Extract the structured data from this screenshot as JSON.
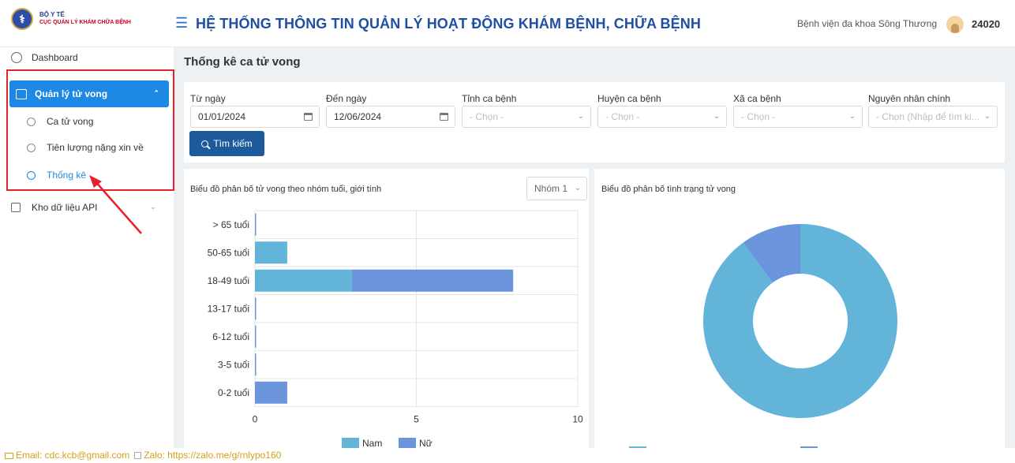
{
  "header": {
    "org_line1": "BỘ Y TẾ",
    "org_line2": "CỤC QUẢN LÝ KHÁM CHỮA BỆNH",
    "title": "HỆ THỐNG THÔNG TIN QUẢN LÝ HOẠT ĐỘNG KHÁM BỆNH, CHỮA BỆNH",
    "hospital": "Bệnh viện đa khoa Sông Thương",
    "user_id": "24020"
  },
  "sidebar": {
    "dashboard": "Dashboard",
    "group_label": "Quản lý tử vong",
    "sub_items": [
      "Ca tử vong",
      "Tiên lượng nặng xin về",
      "Thống kê"
    ],
    "api": "Kho dữ liệu API"
  },
  "page": {
    "title": "Thống kê ca tử vong"
  },
  "filters": {
    "from_label": "Từ ngày",
    "from_value": "01/01/2024",
    "to_label": "Đến ngày",
    "to_value": "12/06/2024",
    "province_label": "Tỉnh ca bệnh",
    "province_placeholder": "- Chọn -",
    "district_label": "Huyện ca bệnh",
    "district_placeholder": "- Chọn -",
    "ward_label": "Xã ca bệnh",
    "ward_placeholder": "- Chọn -",
    "cause_label": "Nguyên nhân chính",
    "cause_placeholder": "- Chọn (Nhập để tìm ki...",
    "search_label": "Tìm kiếm"
  },
  "bar_card": {
    "group_select": "Nhóm 1"
  },
  "donut_card": {},
  "chart_data": [
    {
      "type": "bar",
      "orientation": "horizontal",
      "stacked": true,
      "title": "Biểu đồ phân bố tử vong theo nhóm tuổi, giới tính",
      "categories": [
        "> 65 tuổi",
        "50-65 tuổi",
        "18-49 tuổi",
        "13-17 tuổi",
        "6-12 tuổi",
        "3-5 tuổi",
        "0-2 tuổi"
      ],
      "series": [
        {
          "name": "Nam",
          "values": [
            0,
            1,
            3,
            0,
            0,
            0,
            0
          ],
          "color": "#62b4d9"
        },
        {
          "name": "Nữ",
          "values": [
            0,
            0,
            5,
            0,
            0,
            0,
            1
          ],
          "color": "#6a95dc"
        }
      ],
      "xlim": [
        0,
        10
      ],
      "xticks": [
        "0",
        "5",
        "10"
      ],
      "grid": true,
      "legend": "bottom"
    },
    {
      "type": "pie",
      "donut": true,
      "title": "Biểu đồ phân bố tình trạng tử vong",
      "slices": [
        {
          "value": 90,
          "color": "#62b4d9"
        },
        {
          "value": 10,
          "color": "#6a95dc"
        }
      ],
      "legend": "bottom"
    }
  ],
  "footer": {
    "email": "Email: cdc.kcb@gmail.com",
    "zalo": "Zalo: https://zalo.me/g/rnlypo160"
  },
  "colors": {
    "primary": "#1e88e5",
    "title": "#1f4fa3",
    "button": "#1c5a9c",
    "highlight": "#e8202a"
  }
}
